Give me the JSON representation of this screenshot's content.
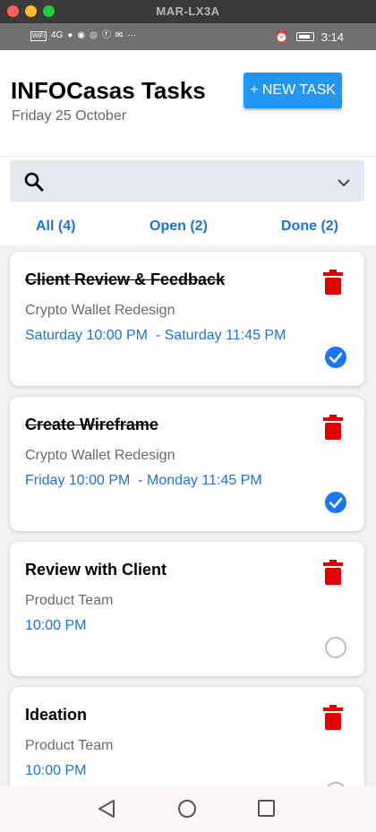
{
  "window": {
    "title": "MAR-LX3A"
  },
  "statusbar": {
    "time": "3:14",
    "wifi_label": "WiFi",
    "signal_label": "4G",
    "more": "···"
  },
  "header": {
    "title": "INFOCasas Tasks",
    "date": "Friday 25 October",
    "new_task_label": "+ NEW TASK"
  },
  "search": {
    "value": "",
    "placeholder": ""
  },
  "tabs": [
    {
      "label": "All (4)"
    },
    {
      "label": "Open (2)"
    },
    {
      "label": "Done (2)"
    }
  ],
  "tasks": [
    {
      "title": "Client Review & Feedback",
      "project": "Crypto Wallet Redesign",
      "time": "Saturday 10:00 PM  - Saturday 11:45 PM",
      "done": true
    },
    {
      "title": "Create Wireframe",
      "project": "Crypto Wallet Redesign",
      "time": "Friday 10:00 PM  - Monday 11:45 PM",
      "done": true
    },
    {
      "title": "Review with Client",
      "project": "Product Team",
      "time": "10:00 PM",
      "done": false
    },
    {
      "title": "Ideation",
      "project": "Product Team",
      "time": "10:00 PM",
      "done": false
    }
  ],
  "colors": {
    "accent": "#2196f3",
    "link": "#1e73d8",
    "delete": "#e00000",
    "check": "#1877f2"
  },
  "icons": [
    "search-icon",
    "chevron-down-icon",
    "trash-icon",
    "check-circle-icon",
    "back-icon",
    "home-icon",
    "recents-icon"
  ]
}
